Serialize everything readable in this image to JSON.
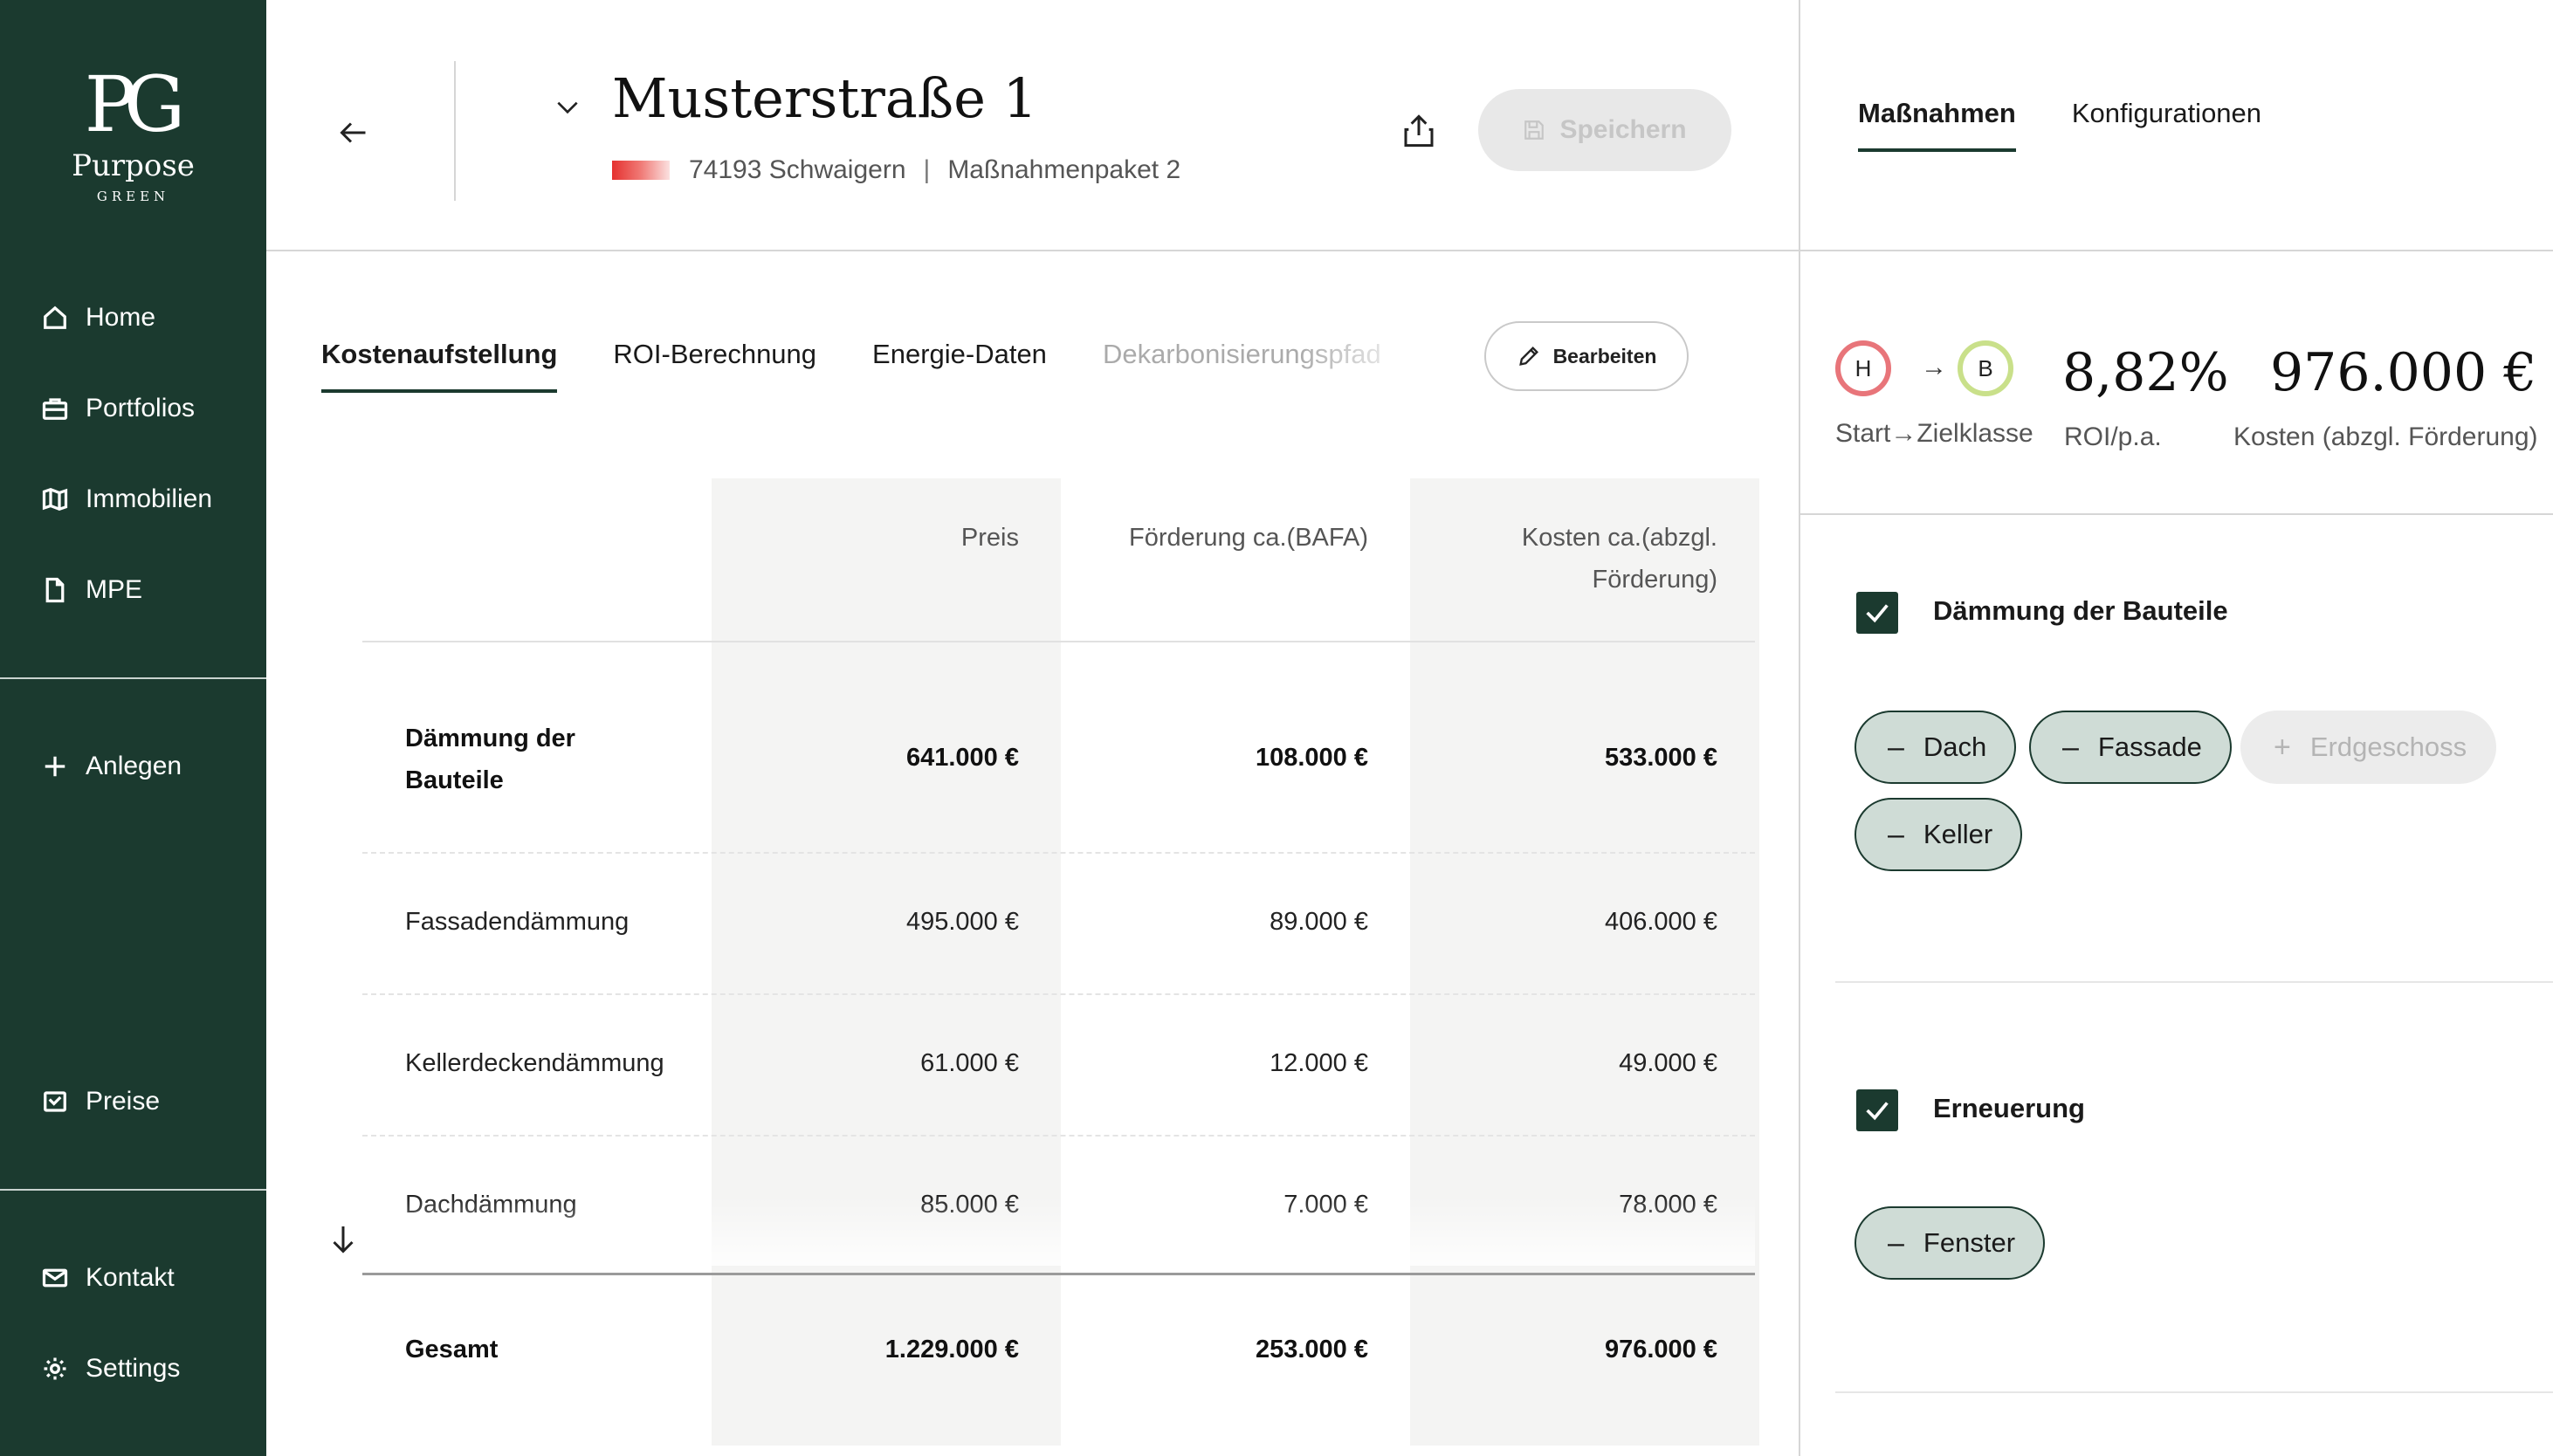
{
  "sidebar": {
    "logo": {
      "mark": "PG",
      "name": "Purpose",
      "sub": "GREEN"
    },
    "nav": {
      "home": "Home",
      "portfolios": "Portfolios",
      "immobilien": "Immobilien",
      "mpe": "MPE",
      "anlegen": "Anlegen",
      "preise": "Preise",
      "kontakt": "Kontakt",
      "settings": "Settings"
    }
  },
  "header": {
    "title": "Musterstraße 1",
    "location": "74193 Schwaigern",
    "separator": "|",
    "package": "Maßnahmenpaket 2",
    "save_label": "Speichern"
  },
  "tabs": {
    "kosten": "Kostenaufstellung",
    "roi": "ROI-Berechnung",
    "energie": "Energie-Daten",
    "dekarb": "Dekarbonisierungspfad",
    "edit_label": "Bearbeiten"
  },
  "table": {
    "headers": {
      "preis": "Preis",
      "foerderung": "Förderung ca.(BAFA)",
      "kosten_1": "Kosten ca.(abzgl.",
      "kosten_2": "Förderung)"
    },
    "group": {
      "name_1": "Dämmung der",
      "name_2": "Bauteile",
      "preis": "641.000 €",
      "foerderung": "108.000 €",
      "kosten": "533.000 €"
    },
    "rows": [
      {
        "name": "Fassadendämmung",
        "preis": "495.000 €",
        "foerderung": "89.000 €",
        "kosten": "406.000 €"
      },
      {
        "name": "Kellerdeckendämmung",
        "preis": "61.000 €",
        "foerderung": "12.000 €",
        "kosten": "49.000 €"
      },
      {
        "name": "Dachdämmung",
        "preis": "85.000 €",
        "foerderung": "7.000 €",
        "kosten": "78.000 €"
      }
    ],
    "total": {
      "name": "Gesamt",
      "preis": "1.229.000 €",
      "foerderung": "253.000 €",
      "kosten": "976.000 €"
    }
  },
  "right_panel": {
    "tabs": {
      "massnahmen": "Maßnahmen",
      "konfig": "Konfigurationen"
    },
    "classes": {
      "start": "H",
      "ziel": "B",
      "start_color": "#e8757a",
      "ziel_color": "#c9e08a",
      "label": "Start→Zielklasse"
    },
    "kpis": {
      "roi_value": "8,82%",
      "roi_label": "ROI/p.a.",
      "kosten_value": "976.000 €",
      "kosten_label": "Kosten (abzgl. Förderung)"
    },
    "sections": [
      {
        "title": "Dämmung der Bauteile",
        "checked": true,
        "chips": [
          {
            "label": "Dach",
            "glyph": "–"
          },
          {
            "label": "Fassade",
            "glyph": "–"
          },
          {
            "label": "Erdgeschoss",
            "glyph": "+"
          },
          {
            "label": "Keller",
            "glyph": "–"
          }
        ]
      },
      {
        "title": "Erneuerung",
        "checked": true,
        "chips": [
          {
            "label": "Fenster",
            "glyph": "–"
          }
        ]
      }
    ]
  },
  "colors": {
    "brand": "#1b3a2f",
    "chip_fill": "#cfdcd6",
    "energy_gradient_start": "#e5312f"
  }
}
